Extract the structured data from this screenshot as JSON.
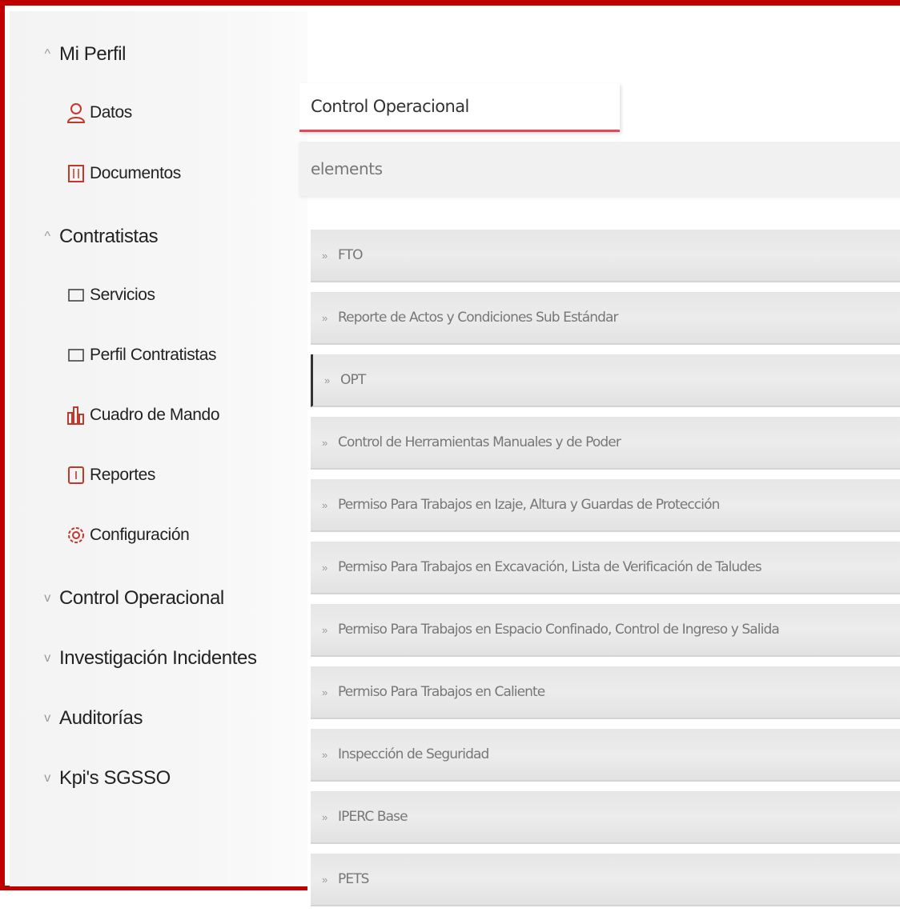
{
  "sidebar": {
    "mi_perfil": "Mi Perfil",
    "datos": "Datos",
    "documentos": "Documentos",
    "contratistas": "Contratistas",
    "servicios": "Servicios",
    "perfil_contratistas": "Perfil Contratistas",
    "cuadro_de_mando": "Cuadro de Mando",
    "reportes": "Reportes",
    "configuracion": "Configuración",
    "control_operacional": "Control Operacional",
    "investigacion_incidentes": "Investigación Incidentes",
    "auditorias": "Auditorías",
    "kpis": "Kpi's SGSSO",
    "chevron_open": "^",
    "chevron_closed": "v"
  },
  "main": {
    "tab_label": "Control Operacional",
    "breadcrumb": "elements",
    "caret": "»",
    "items": [
      {
        "label": "FTO"
      },
      {
        "label": "Reporte de Actos y Condiciones Sub Estándar"
      },
      {
        "label": "OPT"
      },
      {
        "label": "Control de Herramientas Manuales y de Poder"
      },
      {
        "label": "Permiso Para Trabajos en Izaje, Altura y Guardas de Protección"
      },
      {
        "label": "Permiso Para Trabajos en Excavación, Lista de Verificación de Taludes"
      },
      {
        "label": "Permiso Para Trabajos en Espacio Confinado, Control de Ingreso y Salida"
      },
      {
        "label": "Permiso Para Trabajos en Caliente"
      },
      {
        "label": "Inspección de Seguridad"
      },
      {
        "label": "IPERC Base"
      },
      {
        "label": "PETS"
      }
    ]
  },
  "colors": {
    "frame": "#c00000",
    "tab_underline": "#e04a58",
    "icon_accent": "#c0392b"
  },
  "icons": {
    "datos": "user-icon",
    "documentos": "document-icon",
    "servicios": "checkbox-icon",
    "perfil_contratistas": "checkbox-icon",
    "cuadro_de_mando": "bar-chart-icon",
    "reportes": "report-icon",
    "configuracion": "gear-icon"
  }
}
